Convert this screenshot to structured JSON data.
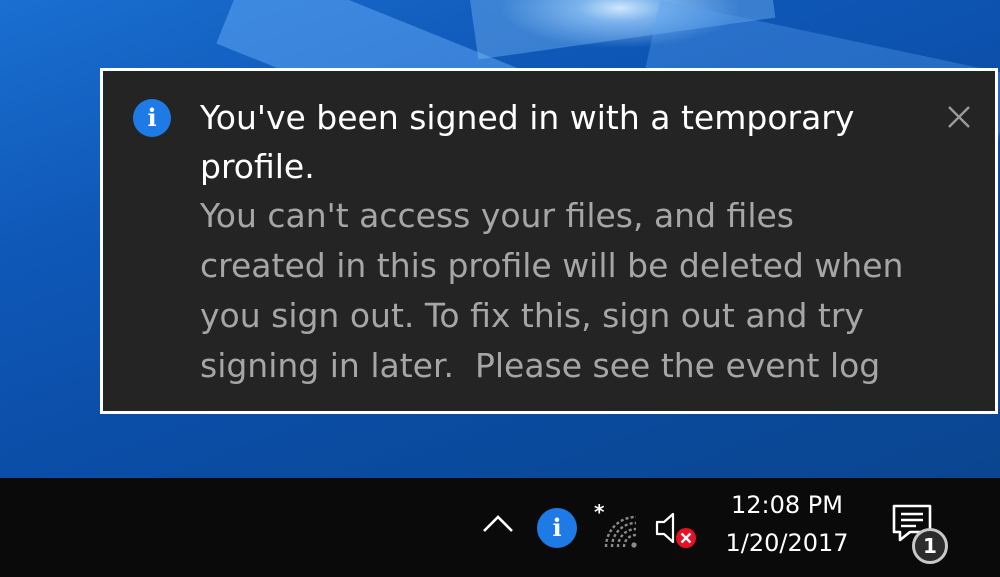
{
  "notification": {
    "icon": "info-icon",
    "title": "You've been signed in with a temporary profile.",
    "body": "You can't access your files, and files created in this profile will be deleted when you sign out. To fix this, sign out and try signing in later.  Please see the event log for details or",
    "close_icon": "close-icon"
  },
  "taskbar": {
    "tray_icons": [
      "chevron-up-icon",
      "info-icon",
      "wifi-icon",
      "volume-muted-icon"
    ],
    "info_glyph": "i",
    "clock": {
      "time": "12:08 PM",
      "date": "1/20/2017"
    },
    "action_center": {
      "icon": "action-center-icon",
      "badge_count": "1"
    }
  },
  "colors": {
    "toast_background": "#242424",
    "toast_border": "#ffffff",
    "info_accent": "#1e7be6",
    "body_text": "#a6a6a6",
    "taskbar": "#0a0a0a",
    "muted_red": "#e81123"
  }
}
